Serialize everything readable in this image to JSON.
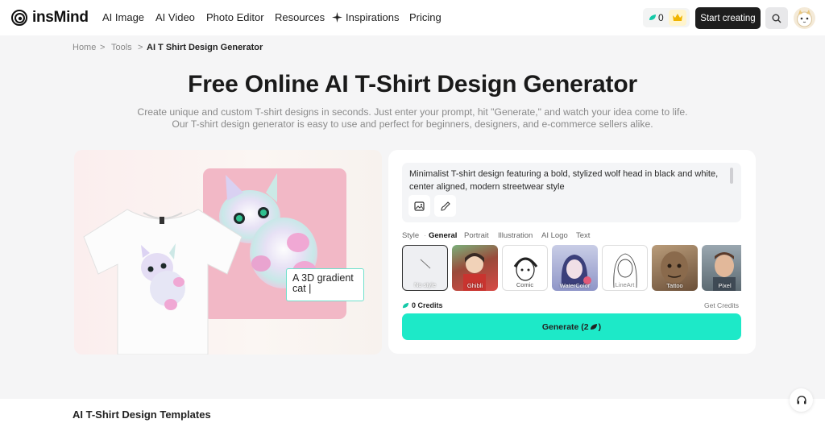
{
  "header": {
    "logo_text": "insMind",
    "nav": [
      "AI Image",
      "AI Video",
      "Photo Editor",
      "Resources",
      "Inspirations",
      "Pricing"
    ],
    "credits": "0",
    "start_button": "Start creating"
  },
  "breadcrumb": {
    "items": [
      "Home",
      "Tools",
      "AI T Shirt Design Generator"
    ],
    "separator": ">"
  },
  "hero": {
    "title": "Free Online AI T-Shirt Design Generator",
    "subtitle": "Create unique and custom T-shirt designs in seconds. Just enter your prompt, hit \"Generate,\" and watch your idea come to life. Our T-shirt design generator is easy to use and perfect for beginners, designers, and e-commerce sellers alike."
  },
  "showcase": {
    "bubble_text": "A 3D gradient cat |"
  },
  "generator": {
    "prompt_text": "Minimalist T-shirt design featuring a bold, stylized wolf head in black and white, center aligned, modern streetwear style",
    "style_tabs": [
      "Style",
      "General",
      "Portrait",
      "Illustration",
      "AI Logo",
      "Text"
    ],
    "active_tab": "General",
    "styles": [
      "No style",
      "Ghibli",
      "Comic",
      "WaterColor",
      "LineArt",
      "Tattoo",
      "Pixel"
    ],
    "credits_label": "0 Credits",
    "get_credits": "Get Credits",
    "generate_label": "Generate (2",
    "generate_suffix": ")"
  },
  "section": {
    "templates_title": "AI T-Shirt Design Templates"
  },
  "colors": {
    "accent": "#1de9c8",
    "dark_button": "#1e1e1e",
    "pink_card": "#f2b8c6"
  }
}
